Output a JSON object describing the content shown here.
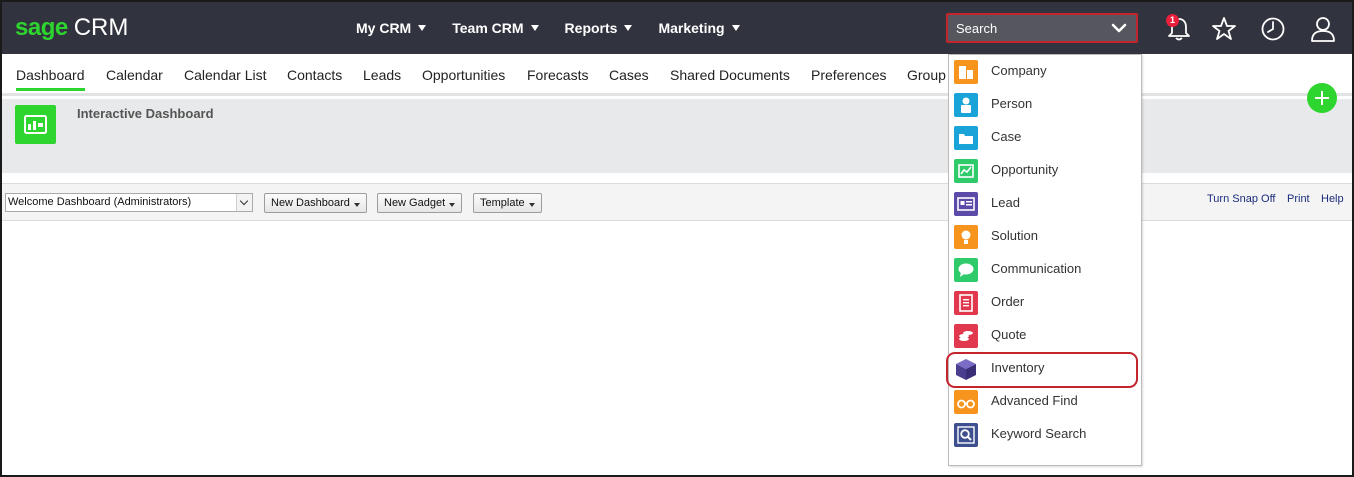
{
  "brand": {
    "part1": "sage",
    "part2": "CRM"
  },
  "topnav": [
    {
      "label": "My CRM"
    },
    {
      "label": "Team CRM"
    },
    {
      "label": "Reports"
    },
    {
      "label": "Marketing"
    }
  ],
  "search": {
    "label": "Search"
  },
  "notifications": {
    "count": "1"
  },
  "tabs": [
    {
      "label": "Dashboard",
      "active": true
    },
    {
      "label": "Calendar"
    },
    {
      "label": "Calendar List"
    },
    {
      "label": "Contacts"
    },
    {
      "label": "Leads"
    },
    {
      "label": "Opportunities"
    },
    {
      "label": "Forecasts"
    },
    {
      "label": "Cases"
    },
    {
      "label": "Shared Documents"
    },
    {
      "label": "Preferences"
    },
    {
      "label": "Group"
    }
  ],
  "page": {
    "title": "Interactive Dashboard"
  },
  "toolbar": {
    "select_value": "Welcome Dashboard (Administrators)",
    "new_dashboard": "New Dashboard",
    "new_gadget": "New Gadget",
    "template": "Template",
    "turn_snap_off": "Turn Snap Off",
    "print": "Print",
    "help": "Help"
  },
  "search_menu": [
    {
      "label": "Company",
      "icon": "company-icon",
      "color": "#f7941d"
    },
    {
      "label": "Person",
      "icon": "person-icon",
      "color": "#1aa3d8"
    },
    {
      "label": "Case",
      "icon": "case-icon",
      "color": "#1aa3d8"
    },
    {
      "label": "Opportunity",
      "icon": "opportunity-icon",
      "color": "#2fcb6b"
    },
    {
      "label": "Lead",
      "icon": "lead-icon",
      "color": "#5b4aa8"
    },
    {
      "label": "Solution",
      "icon": "solution-icon",
      "color": "#f7941d"
    },
    {
      "label": "Communication",
      "icon": "communication-icon",
      "color": "#2fcb6b"
    },
    {
      "label": "Order",
      "icon": "order-icon",
      "color": "#e2384d"
    },
    {
      "label": "Quote",
      "icon": "quote-icon",
      "color": "#e2384d"
    },
    {
      "label": "Inventory",
      "icon": "inventory-icon",
      "color": "#4a3f8f"
    },
    {
      "label": "Advanced Find",
      "icon": "binoculars-icon",
      "color": "#f7941d"
    },
    {
      "label": "Keyword Search",
      "icon": "keyword-search-icon",
      "color": "#3d4f8f"
    }
  ]
}
